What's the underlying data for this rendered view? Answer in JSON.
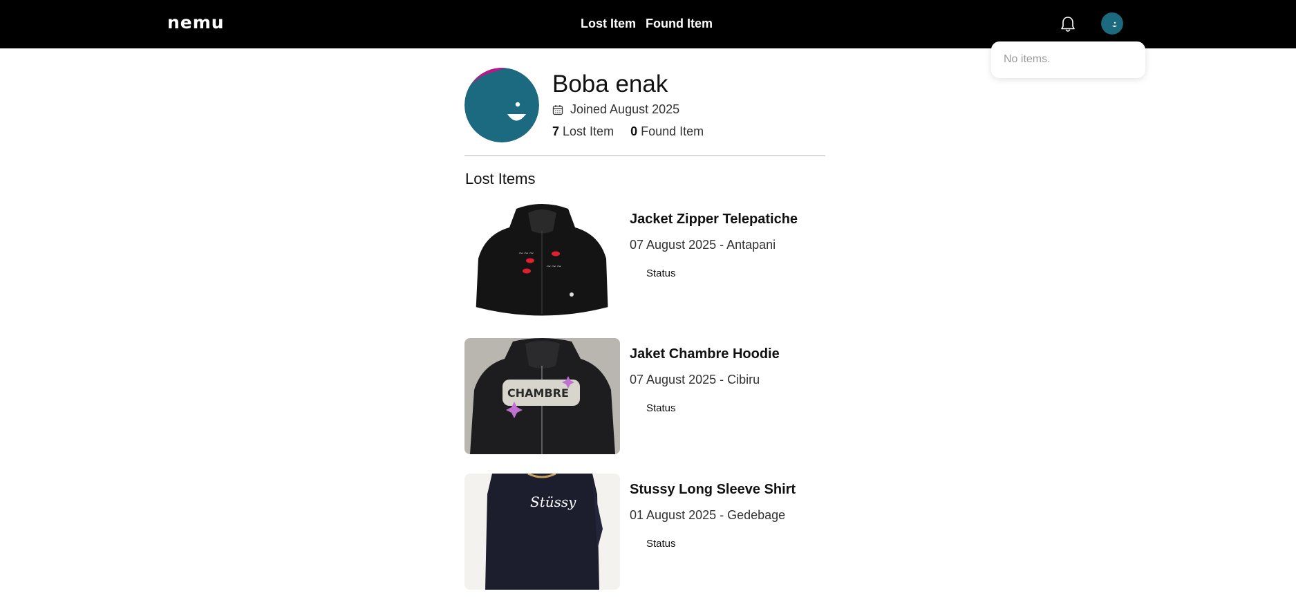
{
  "header": {
    "logo": "nemu",
    "nav": [
      "Lost Item",
      "Found Item"
    ]
  },
  "notifications": {
    "empty_text": "No items."
  },
  "profile": {
    "name": "Boba enak",
    "joined": "Joined August 2025",
    "lost_count": "7",
    "lost_label": "Lost Item",
    "found_count": "0",
    "found_label": "Found Item"
  },
  "section_title": "Lost Items",
  "items": [
    {
      "title": "Jacket Zipper Telepatiche",
      "meta": "07 August 2025 - Antapani",
      "status": "Status"
    },
    {
      "title": "Jaket Chambre Hoodie",
      "meta": "07 August 2025 - Cibiru",
      "status": "Status"
    },
    {
      "title": "Stussy Long Sleeve Shirt",
      "meta": "01 August 2025 - Gedebage",
      "status": "Status"
    }
  ],
  "colors": {
    "header_bg": "#000000",
    "avatar_teal": "#1b6a7f",
    "avatar_accent": "#c0148a"
  }
}
